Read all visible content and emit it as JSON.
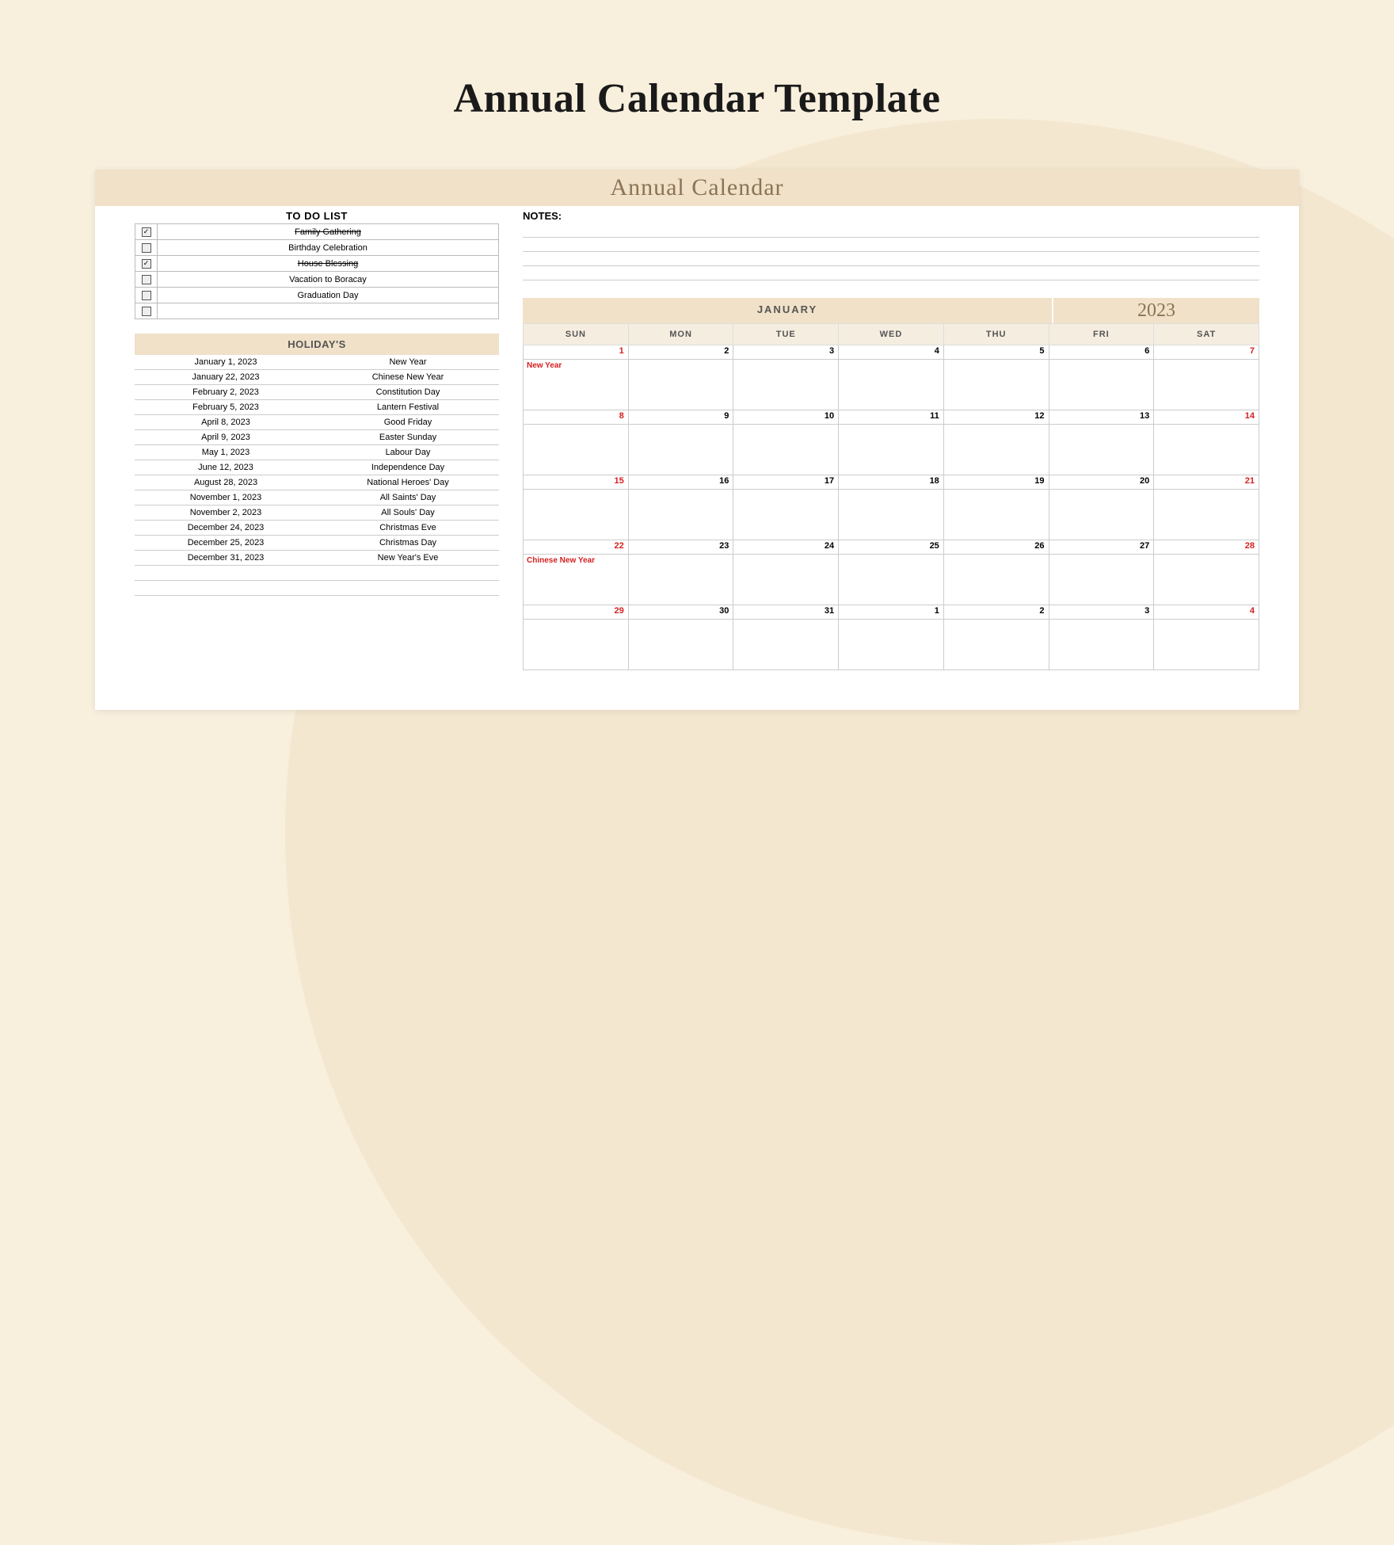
{
  "page_title": "Annual Calendar Template",
  "doc_title": "Annual Calendar",
  "todo": {
    "header": "TO DO LIST",
    "items": [
      {
        "done": true,
        "label": "Family Gathering"
      },
      {
        "done": false,
        "label": "Birthday Celebration"
      },
      {
        "done": true,
        "label": "House Blessing"
      },
      {
        "done": false,
        "label": "Vacation to Boracay"
      },
      {
        "done": false,
        "label": "Graduation Day"
      },
      {
        "done": false,
        "label": ""
      }
    ]
  },
  "holidays": {
    "header": "HOLIDAY'S",
    "rows": [
      {
        "date": "January 1, 2023",
        "name": "New Year"
      },
      {
        "date": "January 22, 2023",
        "name": "Chinese New Year"
      },
      {
        "date": "February 2, 2023",
        "name": "Constitution Day"
      },
      {
        "date": "February 5, 2023",
        "name": "Lantern Festival"
      },
      {
        "date": "April 8, 2023",
        "name": "Good Friday"
      },
      {
        "date": "April 9, 2023",
        "name": "Easter Sunday"
      },
      {
        "date": "May 1, 2023",
        "name": "Labour Day"
      },
      {
        "date": "June 12, 2023",
        "name": "Independence Day"
      },
      {
        "date": "August 28, 2023",
        "name": "National Heroes' Day"
      },
      {
        "date": "November 1, 2023",
        "name": "All Saints' Day"
      },
      {
        "date": "November 2, 2023",
        "name": "All Souls' Day"
      },
      {
        "date": "December 24, 2023",
        "name": "Christmas Eve"
      },
      {
        "date": "December 25, 2023",
        "name": "Christmas Day"
      },
      {
        "date": "December 31, 2023",
        "name": "New Year's Eve"
      }
    ]
  },
  "notes_label": "NOTES:",
  "calendar": {
    "month": "JANUARY",
    "year": "2023",
    "days": [
      "SUN",
      "MON",
      "TUE",
      "WED",
      "THU",
      "FRI",
      "SAT"
    ],
    "weeks": [
      [
        {
          "n": "1",
          "red": true,
          "ev": "New Year"
        },
        {
          "n": "2"
        },
        {
          "n": "3"
        },
        {
          "n": "4"
        },
        {
          "n": "5"
        },
        {
          "n": "6"
        },
        {
          "n": "7",
          "red": true
        }
      ],
      [
        {
          "n": "8",
          "red": true
        },
        {
          "n": "9"
        },
        {
          "n": "10"
        },
        {
          "n": "11"
        },
        {
          "n": "12"
        },
        {
          "n": "13"
        },
        {
          "n": "14",
          "red": true
        }
      ],
      [
        {
          "n": "15",
          "red": true
        },
        {
          "n": "16"
        },
        {
          "n": "17"
        },
        {
          "n": "18"
        },
        {
          "n": "19"
        },
        {
          "n": "20"
        },
        {
          "n": "21",
          "red": true
        }
      ],
      [
        {
          "n": "22",
          "red": true,
          "ev": "Chinese New Year"
        },
        {
          "n": "23"
        },
        {
          "n": "24"
        },
        {
          "n": "25"
        },
        {
          "n": "26"
        },
        {
          "n": "27"
        },
        {
          "n": "28",
          "red": true
        }
      ],
      [
        {
          "n": "29",
          "red": true
        },
        {
          "n": "30"
        },
        {
          "n": "31"
        },
        {
          "n": "1"
        },
        {
          "n": "2"
        },
        {
          "n": "3"
        },
        {
          "n": "4",
          "red": true
        }
      ]
    ]
  }
}
